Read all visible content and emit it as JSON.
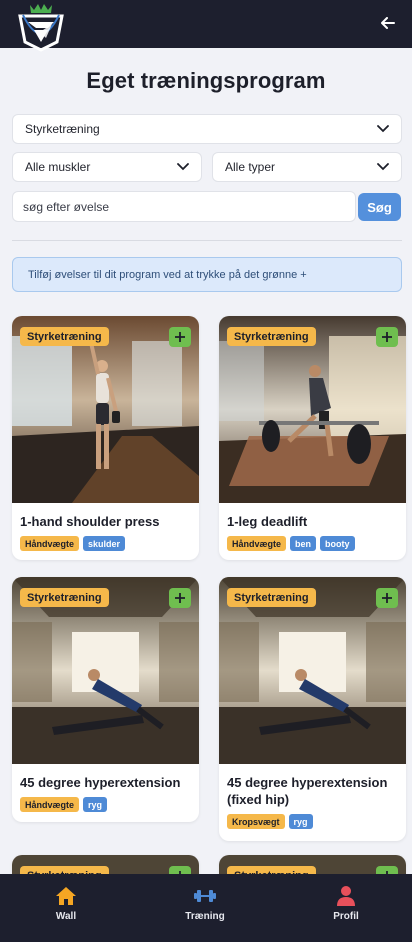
{
  "header": {
    "logo_icon": "crown-shield-logo",
    "back_icon": "arrow-left-icon"
  },
  "page_title": "Eget træningsprogram",
  "filters": {
    "category": "Styrketræning",
    "muscles": "Alle muskler",
    "types": "Alle typer"
  },
  "search": {
    "placeholder": "søg efter øvelse",
    "button_label": "Søg"
  },
  "info_text": "Tilføj øvelser til dit program ved at trykke på det grønne +",
  "exercises": [
    {
      "category": "Styrketræning",
      "name": "1-hand shoulder press",
      "equipment": "Håndvægte",
      "muscles": [
        "skulder"
      ]
    },
    {
      "category": "Styrketræning",
      "name": "1-leg deadlift",
      "equipment": "Håndvægte",
      "muscles": [
        "ben",
        "booty"
      ]
    },
    {
      "category": "Styrketræning",
      "name": "45 degree hyperextension",
      "equipment": "Håndvægte",
      "muscles": [
        "ryg"
      ]
    },
    {
      "category": "Styrketræning",
      "name": "45 degree hyperextension (fixed hip)",
      "equipment": "Kropsvægt",
      "muscles": [
        "ryg"
      ]
    },
    {
      "category": "Styrketræning"
    },
    {
      "category": "Styrketræning"
    }
  ],
  "nav": {
    "wall": "Wall",
    "training": "Træning",
    "profile": "Profil"
  },
  "colors": {
    "header_bg": "#1d1f2e",
    "accent_blue": "#5490dc",
    "badge_yellow": "#f5b84a",
    "add_green": "#6fbe4f",
    "nav_active_orange": "#f5a623",
    "nav_training_blue": "#4e8ad6",
    "nav_profile_red": "#e8505b"
  }
}
